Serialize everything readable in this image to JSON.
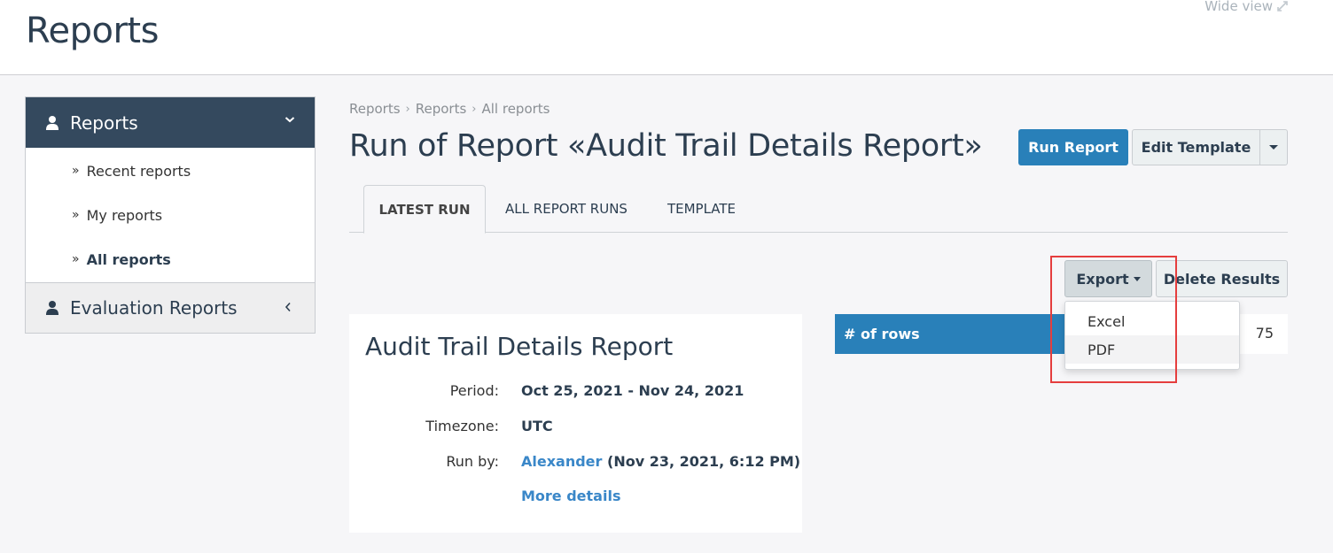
{
  "header": {
    "title": "Reports",
    "wide_view_label": "Wide view"
  },
  "sidebar": {
    "sections": [
      {
        "label": "Reports",
        "expanded": true,
        "items": [
          {
            "label": "Recent reports",
            "active": false
          },
          {
            "label": "My reports",
            "active": false
          },
          {
            "label": "All reports",
            "active": true
          }
        ]
      },
      {
        "label": "Evaluation Reports",
        "expanded": false
      }
    ],
    "item_prefix": "»"
  },
  "breadcrumb": [
    "Reports",
    "Reports",
    "All reports"
  ],
  "breadcrumb_separator": "›",
  "page": {
    "title": "Run of Report «Audit Trail Details Report»",
    "run_report_label": "Run Report",
    "edit_template_label": "Edit Template"
  },
  "tabs": [
    {
      "label": "LATEST RUN",
      "active": true
    },
    {
      "label": "ALL REPORT RUNS",
      "active": false
    },
    {
      "label": "TEMPLATE",
      "active": false
    }
  ],
  "actions": {
    "export_label": "Export",
    "delete_label": "Delete Results",
    "export_menu": [
      "Excel",
      "PDF"
    ],
    "hovered_item": "PDF"
  },
  "report_card": {
    "title": "Audit Trail Details Report",
    "period_label": "Period:",
    "period_value": "Oct 25, 2021 - Nov 24, 2021",
    "timezone_label": "Timezone:",
    "timezone_value": "UTC",
    "run_by_label": "Run by:",
    "run_by_user": "Alexander",
    "run_by_time": "(Nov 23, 2021, 6:12 PM)",
    "more_details_label": "More details"
  },
  "stats": {
    "rows_label": "# of rows",
    "rows_value": "75"
  },
  "colors": {
    "primary": "#2980b9",
    "sidebar_header": "#34495e",
    "link": "#3a87c8",
    "highlight": "#e53e3e"
  }
}
